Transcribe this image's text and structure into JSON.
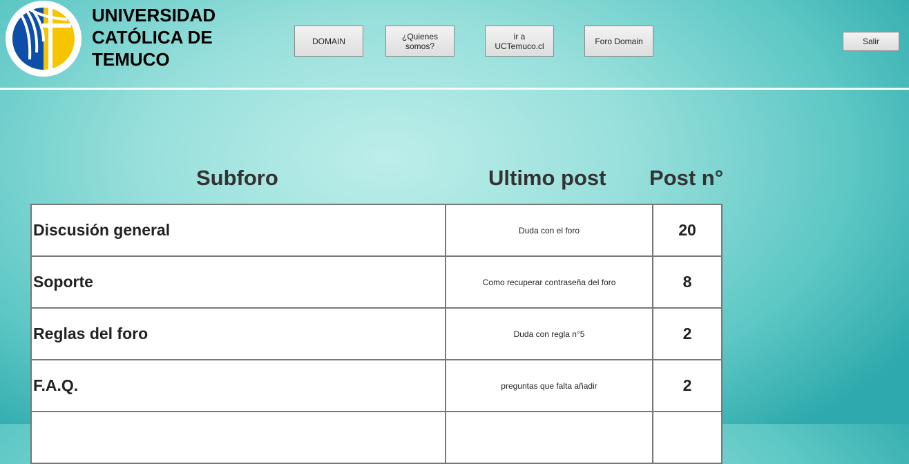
{
  "header": {
    "university_lines": [
      "UNIVERSIDAD",
      "CATÓLICA DE",
      "TEMUCO"
    ],
    "nav": [
      {
        "label": "DOMAIN"
      },
      {
        "label": "¿Quienes somos?"
      },
      {
        "label": "ir a UCTemuco.cl"
      },
      {
        "label": "Foro Domain"
      }
    ],
    "logout_label": "Salir"
  },
  "table": {
    "headers": {
      "subforo": "Subforo",
      "ultimo_post": "Ultimo post",
      "post_n": "Post n°"
    },
    "rows": [
      {
        "subforo": "Discusión general",
        "ultimo_post": "Duda con el foro",
        "post_n": "20"
      },
      {
        "subforo": "Soporte",
        "ultimo_post": "Como recuperar contraseña del foro",
        "post_n": "8"
      },
      {
        "subforo": "Reglas del foro",
        "ultimo_post": "Duda con regla n°5",
        "post_n": "2"
      },
      {
        "subforo": "F.A.Q.",
        "ultimo_post": "preguntas que falta añadir",
        "post_n": "2"
      },
      {
        "subforo": "",
        "ultimo_post": "",
        "post_n": ""
      }
    ]
  },
  "colors": {
    "logo_blue": "#0d4fa8",
    "logo_yellow": "#f7c400"
  }
}
